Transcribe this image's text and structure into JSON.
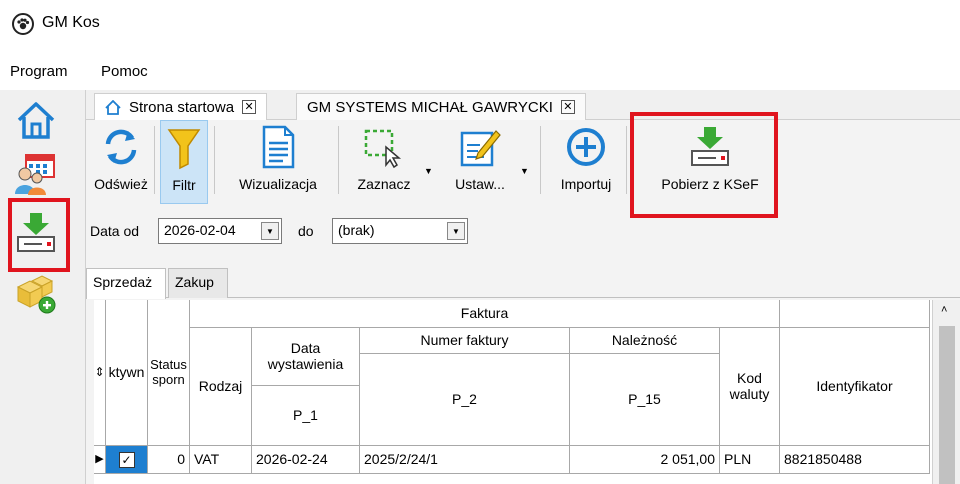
{
  "window": {
    "title": "GM Kos"
  },
  "menu": [
    {
      "label": "Program"
    },
    {
      "label": "Pomoc"
    }
  ],
  "doc_tabs": [
    {
      "label": "Strona startowa"
    },
    {
      "label": "GM SYSTEMS MICHAŁ GAWRYCKI"
    }
  ],
  "ribbon": {
    "refresh": "Odśwież",
    "filter": "Filtr",
    "visualization": "Wizualizacja",
    "select": "Zaznacz",
    "settings": "Ustaw...",
    "import": "Importuj",
    "fetch_ksef": "Pobierz z KSeF"
  },
  "filter": {
    "date_from_label": "Data od",
    "date_from_value": "2026-02-04",
    "to_label": "do",
    "to_value": "(brak)"
  },
  "sub_tabs": [
    {
      "label": "Sprzedaż"
    },
    {
      "label": "Zakup"
    }
  ],
  "table": {
    "group_header": "Faktura",
    "col_active": "ktywn",
    "col_status": "Status sporn",
    "col_type": "Rodzaj",
    "col_date": "Data wystawienia",
    "col_date_code": "P_1",
    "col_number": "Numer faktury",
    "col_number_code": "P_2",
    "col_amount": "Należność",
    "col_amount_code": "P_15",
    "col_currency": "Kod waluty",
    "col_id": "Identyfikator",
    "rows": [
      {
        "status": "0",
        "type": "VAT",
        "date": "2026-02-24",
        "number": "2025/2/24/1",
        "amount": "2 051,00",
        "currency": "PLN",
        "id": "8821850488"
      }
    ]
  },
  "colors": {
    "accent_blue": "#1e7fd0",
    "green": "#3aa935",
    "highlight": "#e0141e",
    "filter_yellow": "#f2c31b"
  }
}
